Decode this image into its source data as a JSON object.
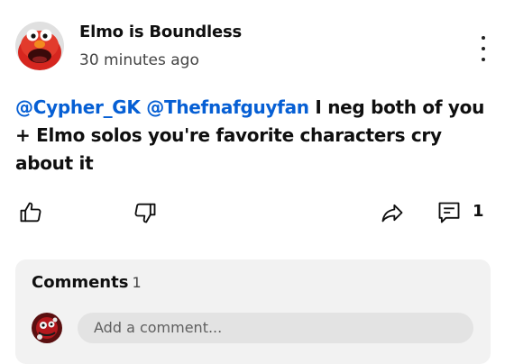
{
  "post": {
    "author": "Elmo is Boundless",
    "time": "30 minutes ago",
    "mentions": [
      "@Cypher_GK",
      "@Thefnafguyfan"
    ],
    "text": "I neg both of you + Elmo solos you're favorite characters cry about it"
  },
  "actions": {
    "like_icon": "thumbs-up-icon",
    "dislike_icon": "thumbs-down-icon",
    "share_icon": "share-arrow-icon",
    "comment_icon": "comment-icon",
    "reply_count": "1"
  },
  "comments": {
    "title": "Comments",
    "count": "1",
    "placeholder": "Add a comment..."
  },
  "colors": {
    "mention": "#065fd4",
    "panel_bg": "#f2f2f2",
    "input_bg": "#e3e3e3"
  }
}
